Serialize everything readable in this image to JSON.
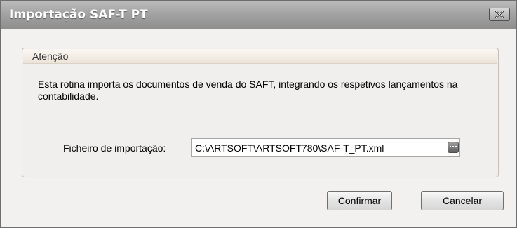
{
  "window": {
    "title": "Importação SAF-T PT",
    "close_icon": "close-icon"
  },
  "group": {
    "title": "Atenção",
    "description": "Esta rotina importa os documentos de venda do SAFT, integrando os respetivos lançamentos na contabilidade."
  },
  "file": {
    "label": "Ficheiro de importação:",
    "value": "C:\\ARTSOFT\\ARTSOFT780\\SAF-T_PT.xml",
    "browse_icon": "ellipsis-icon"
  },
  "buttons": {
    "confirm": "Confirmar",
    "cancel": "Cancelar"
  },
  "colors": {
    "titlebar": "#a4a4a4",
    "title_text": "#ffffff",
    "client_bg": "#f2f1ef",
    "group_border": "#c9bfb5"
  }
}
